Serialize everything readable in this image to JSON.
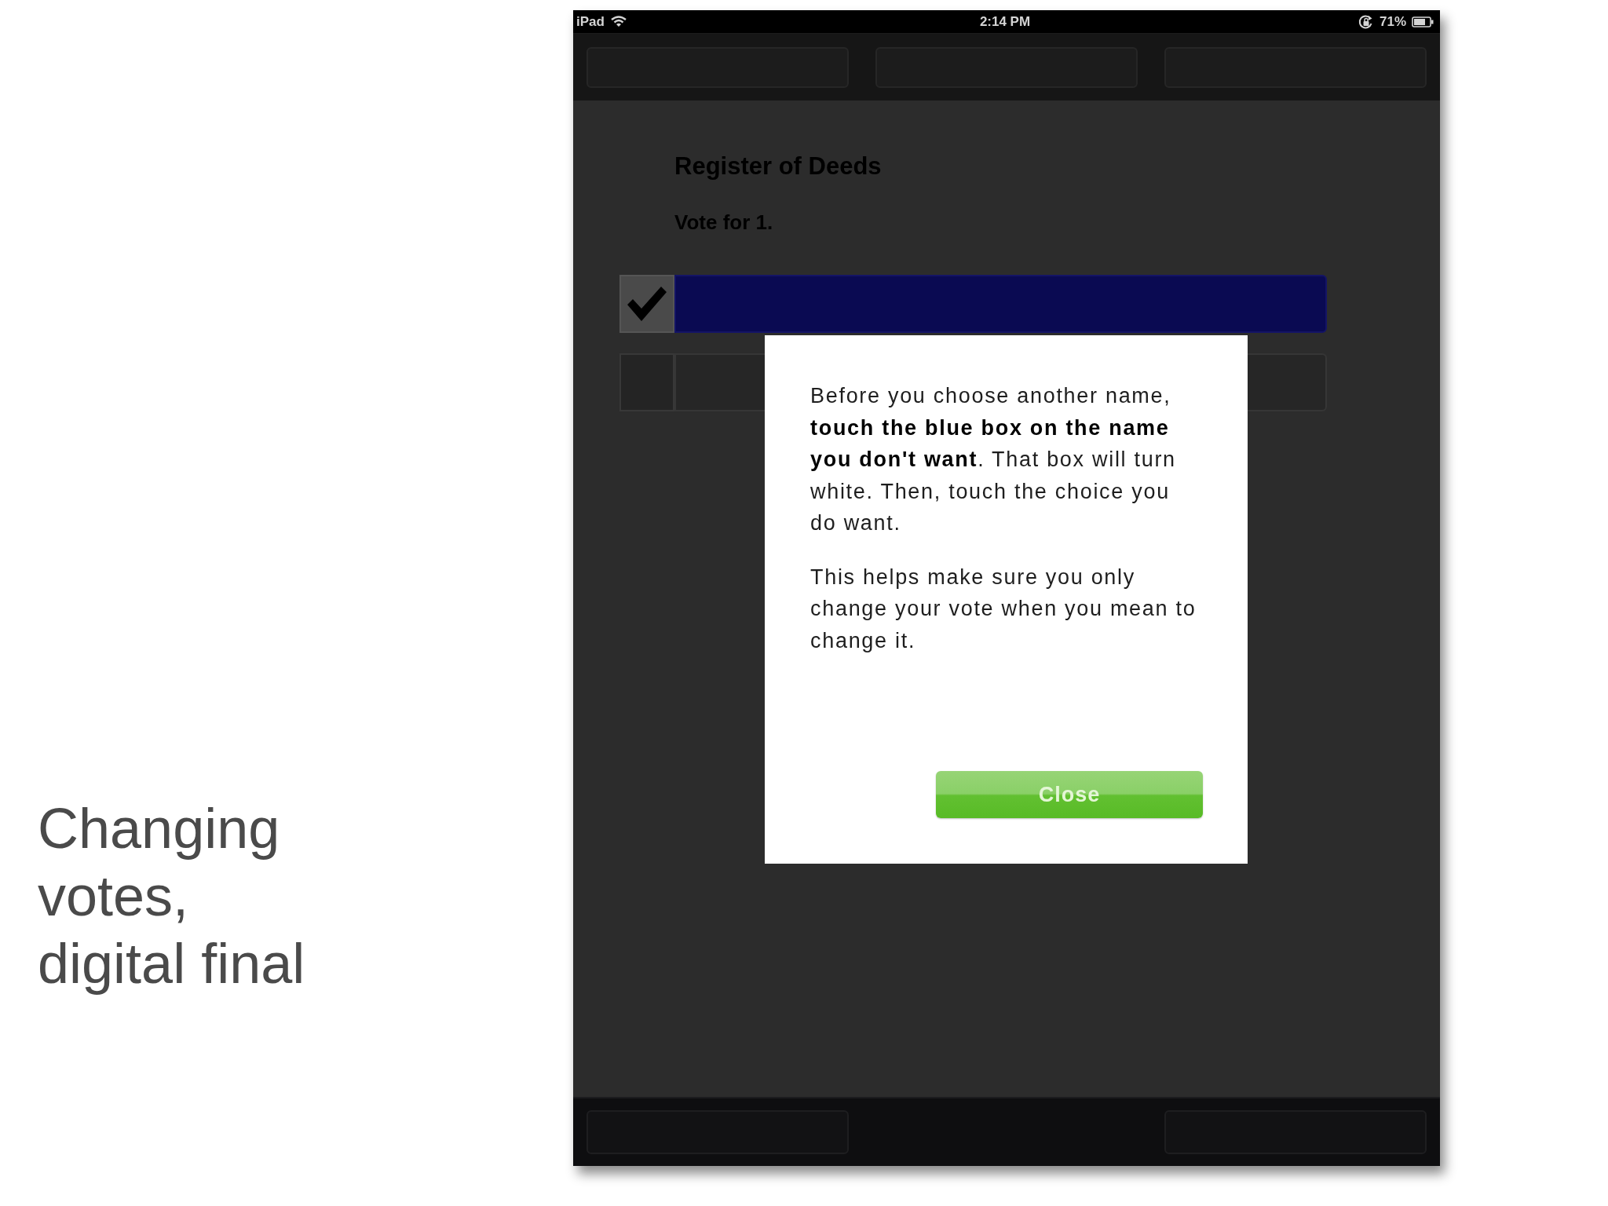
{
  "slide": {
    "caption": "Changing votes, digital final"
  },
  "status_bar": {
    "device": "iPad",
    "time": "2:14 PM",
    "battery": "71%"
  },
  "contest": {
    "title": "Register of Deeds",
    "instruction": "Vote for 1."
  },
  "candidates": [
    {
      "selected": true
    },
    {
      "selected": false
    }
  ],
  "dialog": {
    "paragraphs": [
      "Before you choose another name, **touch the blue box on the name you don't want**. That box will turn white. Then, touch the choice you do want.",
      "This helps make sure you only change your vote when you mean to change it."
    ],
    "button": "Close"
  }
}
